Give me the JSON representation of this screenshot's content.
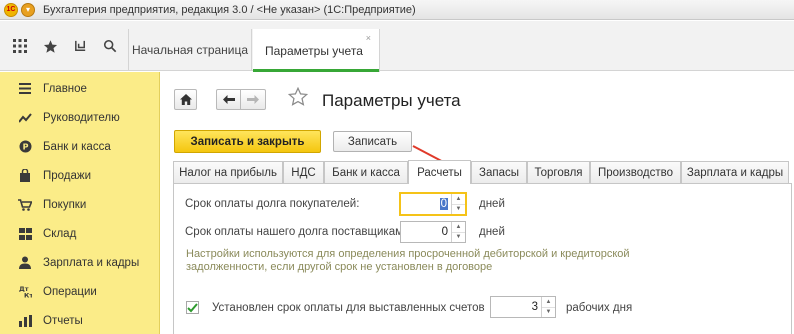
{
  "window": {
    "title": "Бухгалтерия предприятия, редакция 3.0 / <Не указан>  (1С:Предприятие)",
    "logo_text": "1С",
    "menu_glyph": "▾"
  },
  "toolbar": {
    "icons": [
      "apps-grid-icon",
      "star-icon",
      "history-icon",
      "search-icon"
    ]
  },
  "tabs": {
    "home_label": "Начальная страница",
    "active_label": "Параметры учета",
    "close_glyph": "×"
  },
  "sidebar": {
    "items": [
      {
        "label": "Главное",
        "icon": "menu-lines-icon"
      },
      {
        "label": "Руководителю",
        "icon": "trend-icon"
      },
      {
        "label": "Банк и касса",
        "icon": "coin-icon"
      },
      {
        "label": "Продажи",
        "icon": "bag-icon"
      },
      {
        "label": "Покупки",
        "icon": "cart-icon"
      },
      {
        "label": "Склад",
        "icon": "warehouse-icon"
      },
      {
        "label": "Зарплата и кадры",
        "icon": "person-icon"
      },
      {
        "label": "Операции",
        "icon": "operations-icon"
      },
      {
        "label": "Отчеты",
        "icon": "chart-icon"
      }
    ]
  },
  "page": {
    "title": "Параметры учета",
    "save_close_label": "Записать и закрыть",
    "save_label": "Записать"
  },
  "subtabs": [
    {
      "label": "Налог на прибыль",
      "active": false
    },
    {
      "label": "НДС",
      "active": false
    },
    {
      "label": "Банк и касса",
      "active": false
    },
    {
      "label": "Расчеты",
      "active": true
    },
    {
      "label": "Запасы",
      "active": false
    },
    {
      "label": "Торговля",
      "active": false
    },
    {
      "label": "Производство",
      "active": false
    },
    {
      "label": "Зарплата и кадры",
      "active": false
    }
  ],
  "settlements": {
    "buyers_label": "Срок оплаты долга покупателей:",
    "buyers_value": "0",
    "buyers_unit": "дней",
    "suppliers_label": "Срок оплаты нашего долга поставщикам:",
    "suppliers_value": "0",
    "suppliers_unit": "дней",
    "note_line1": "Настройки используются для определения просроченной дебиторской и кредиторской",
    "note_line2": "задолженности, если другой срок не установлен в договоре",
    "invoice_checkbox_label": "Установлен срок оплаты для выставленных счетов",
    "invoice_checked": true,
    "invoice_value": "3",
    "invoice_unit": "рабочих дня"
  },
  "colors": {
    "sidebar_bg": "#fbec88",
    "primary_button": "#f4c60f",
    "active_tab_underline": "#37a736",
    "annotation_arrow": "#e03a2a"
  }
}
